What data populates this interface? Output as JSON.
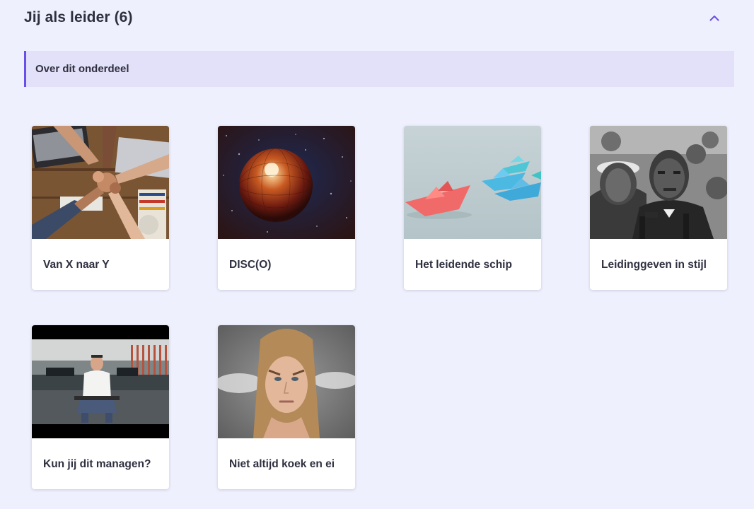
{
  "section": {
    "title": "Jij als leider (6)",
    "collapse_icon": "chevron-up-icon",
    "about_label": "Over dit onderdeel"
  },
  "colors": {
    "accent": "#6a4ee8",
    "background": "#eff0fd",
    "about_background": "#e3e1f9"
  },
  "cards": [
    {
      "title": "Van X naar Y",
      "image": "team-fist-bump-photo"
    },
    {
      "title": "DISC(O)",
      "image": "disco-ball-photo"
    },
    {
      "title": "Het leidende schip",
      "image": "paper-boats-photo"
    },
    {
      "title": "Leidinggeven in stijl",
      "image": "black-and-white-speaker-photo"
    },
    {
      "title": "Kun jij dit managen?",
      "image": "man-seated-in-office-video-still"
    },
    {
      "title": "Niet altijd koek en ei",
      "image": "angry-woman-steam-ears-photo"
    }
  ]
}
